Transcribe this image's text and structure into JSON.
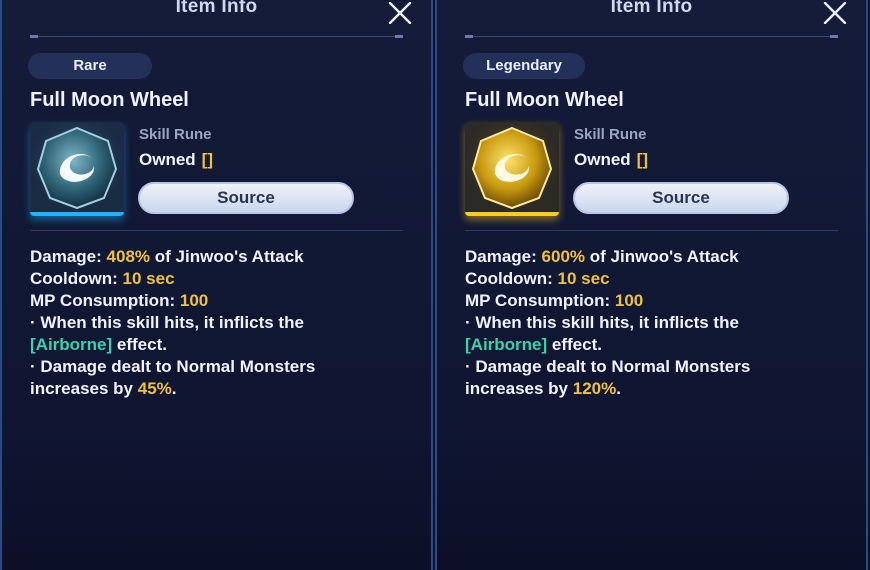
{
  "panels": [
    {
      "title": "Item Info",
      "rarity": "Rare",
      "item_name": "Full Moon Wheel",
      "item_type": "Skill Rune",
      "owned_label": "Owned",
      "owned_value": "[]",
      "source_button": "Source",
      "rune_color": "blue",
      "stats": {
        "damage_label": "Damage:",
        "damage_value": "408%",
        "damage_suffix": "of Jinwoo's Attack",
        "cooldown_label": "Cooldown:",
        "cooldown_value": "10 sec",
        "mp_label": "MP Consumption:",
        "mp_value": "100",
        "bullet1_text": "· When this skill hits, it inflicts the",
        "bullet1_tag": "[Airborne]",
        "bullet1_end": "effect.",
        "bullet2_text": "· Damage dealt to Normal Monsters",
        "bullet2_prefix": "increases by",
        "bullet2_value": "45%",
        "bullet2_end": "."
      }
    },
    {
      "title": "Item Info",
      "rarity": "Legendary",
      "item_name": "Full Moon Wheel",
      "item_type": "Skill Rune",
      "owned_label": "Owned",
      "owned_value": "[]",
      "source_button": "Source",
      "rune_color": "gold",
      "stats": {
        "damage_label": "Damage:",
        "damage_value": "600%",
        "damage_suffix": "of Jinwoo's Attack",
        "cooldown_label": "Cooldown:",
        "cooldown_value": "10 sec",
        "mp_label": "MP Consumption:",
        "mp_value": "100",
        "bullet1_text": "· When this skill hits, it inflicts the",
        "bullet1_tag": "[Airborne]",
        "bullet1_end": "effect.",
        "bullet2_text": "· Damage dealt to Normal Monsters",
        "bullet2_prefix": "increases by",
        "bullet2_value": "120%",
        "bullet2_end": "."
      }
    }
  ],
  "colors": {
    "highlight_yellow": "#f0c23a",
    "highlight_green": "#35d4b0",
    "rare_accent": "#1fb3ff",
    "legendary_accent": "#ffcc1f"
  }
}
